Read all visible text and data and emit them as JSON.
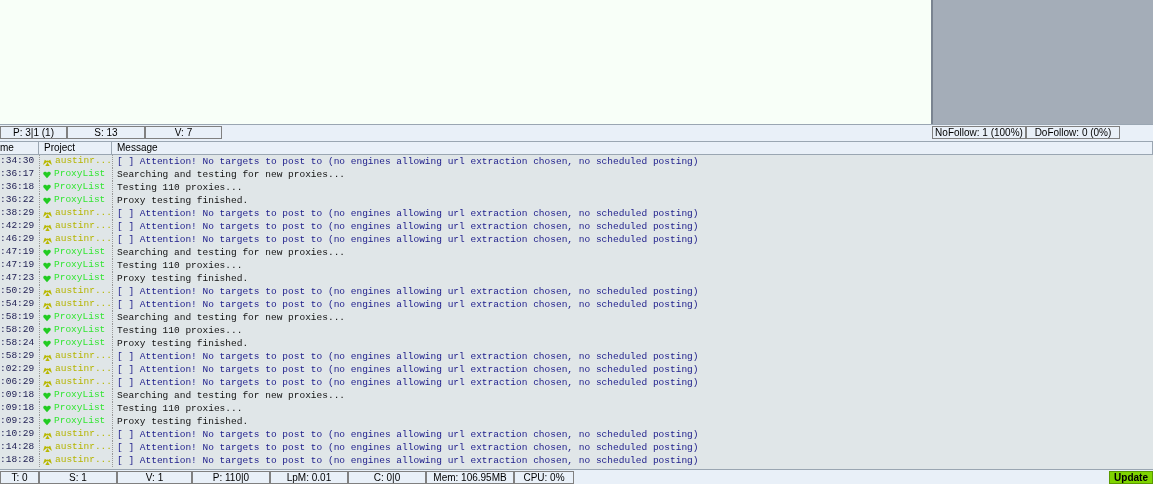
{
  "top_status": {
    "left": [
      "P: 3|1 (1)",
      "S: 13",
      "V: 7"
    ],
    "right": [
      "NoFollow: 1 (100%)",
      "DoFollow: 0 (0%)"
    ]
  },
  "log": {
    "columns": [
      "me",
      "Project",
      "Message"
    ],
    "rows": [
      {
        "kind": "warning",
        "time": ":34:30",
        "project": "austinr...",
        "message": "[ ] Attention! No targets to post to (no engines allowing url extraction chosen, no scheduled posting)"
      },
      {
        "kind": "proxy",
        "time": ":36:17",
        "project": "ProxyList",
        "message": "Searching and testing for new proxies..."
      },
      {
        "kind": "proxy",
        "time": ":36:18",
        "project": "ProxyList",
        "message": "Testing 110 proxies..."
      },
      {
        "kind": "proxy",
        "time": ":36:22",
        "project": "ProxyList",
        "message": "Proxy testing finished."
      },
      {
        "kind": "warning",
        "time": ":38:29",
        "project": "austinr...",
        "message": "[ ] Attention! No targets to post to (no engines allowing url extraction chosen, no scheduled posting)"
      },
      {
        "kind": "warning",
        "time": ":42:29",
        "project": "austinr...",
        "message": "[ ] Attention! No targets to post to (no engines allowing url extraction chosen, no scheduled posting)"
      },
      {
        "kind": "warning",
        "time": ":46:29",
        "project": "austinr...",
        "message": "[ ] Attention! No targets to post to (no engines allowing url extraction chosen, no scheduled posting)"
      },
      {
        "kind": "proxy",
        "time": ":47:19",
        "project": "ProxyList",
        "message": "Searching and testing for new proxies..."
      },
      {
        "kind": "proxy",
        "time": ":47:19",
        "project": "ProxyList",
        "message": "Testing 110 proxies..."
      },
      {
        "kind": "proxy",
        "time": ":47:23",
        "project": "ProxyList",
        "message": "Proxy testing finished."
      },
      {
        "kind": "warning",
        "time": ":50:29",
        "project": "austinr...",
        "message": "[ ] Attention! No targets to post to (no engines allowing url extraction chosen, no scheduled posting)"
      },
      {
        "kind": "warning",
        "time": ":54:29",
        "project": "austinr...",
        "message": "[ ] Attention! No targets to post to (no engines allowing url extraction chosen, no scheduled posting)"
      },
      {
        "kind": "proxy",
        "time": ":58:19",
        "project": "ProxyList",
        "message": "Searching and testing for new proxies..."
      },
      {
        "kind": "proxy",
        "time": ":58:20",
        "project": "ProxyList",
        "message": "Testing 110 proxies..."
      },
      {
        "kind": "proxy",
        "time": ":58:24",
        "project": "ProxyList",
        "message": "Proxy testing finished."
      },
      {
        "kind": "warning",
        "time": ":58:29",
        "project": "austinr...",
        "message": "[ ] Attention! No targets to post to (no engines allowing url extraction chosen, no scheduled posting)"
      },
      {
        "kind": "warning",
        "time": ":02:29",
        "project": "austinr...",
        "message": "[ ] Attention! No targets to post to (no engines allowing url extraction chosen, no scheduled posting)"
      },
      {
        "kind": "warning",
        "time": ":06:29",
        "project": "austinr...",
        "message": "[ ] Attention! No targets to post to (no engines allowing url extraction chosen, no scheduled posting)"
      },
      {
        "kind": "proxy",
        "time": ":09:18",
        "project": "ProxyList",
        "message": "Searching and testing for new proxies..."
      },
      {
        "kind": "proxy",
        "time": ":09:18",
        "project": "ProxyList",
        "message": "Testing 110 proxies..."
      },
      {
        "kind": "proxy",
        "time": ":09:23",
        "project": "ProxyList",
        "message": "Proxy testing finished."
      },
      {
        "kind": "warning",
        "time": ":10:29",
        "project": "austinr...",
        "message": "[ ] Attention! No targets to post to (no engines allowing url extraction chosen, no scheduled posting)"
      },
      {
        "kind": "warning",
        "time": ":14:28",
        "project": "austinr...",
        "message": "[ ] Attention! No targets to post to (no engines allowing url extraction chosen, no scheduled posting)"
      },
      {
        "kind": "warning",
        "time": ":18:28",
        "project": "austinr...",
        "message": "[ ] Attention! No targets to post to (no engines allowing url extraction chosen, no scheduled posting)"
      }
    ]
  },
  "bottom_status": {
    "cells": [
      "T: 0",
      "S: 1",
      "V: 1",
      "P: 110|0",
      "LpM: 0.01",
      "C: 0|0",
      "Mem: 106.95MB",
      "CPU: 0%"
    ],
    "update_button": "Update"
  }
}
